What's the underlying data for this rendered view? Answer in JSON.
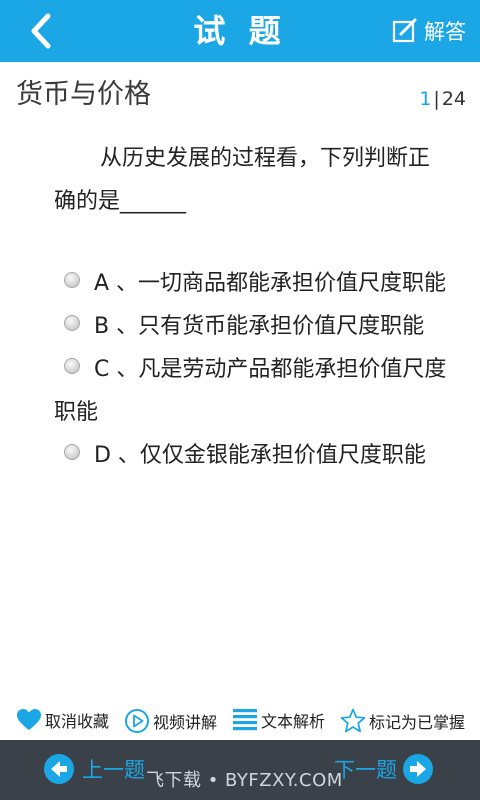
{
  "header": {
    "title": "试 题",
    "answer_label": "解答"
  },
  "subject": "货币与价格",
  "counter": {
    "current": "1",
    "separator": "|",
    "total": "24"
  },
  "question": {
    "line1": "从历史发展的过程看，下列判断正",
    "line2": "确的是______"
  },
  "options": [
    {
      "text": "A 、一切商品都能承担价值尺度职能"
    },
    {
      "text": "B 、只有货币能承担价值尺度职能"
    },
    {
      "text": "C 、凡是劳动产品都能承担价值尺度职能"
    },
    {
      "text": "D 、仅仅金银能承担价值尺度职能"
    }
  ],
  "actions": {
    "unfavorite": "取消收藏",
    "video": "视频讲解",
    "text_analysis": "文本解析",
    "mark_mastered": "标记为已掌握"
  },
  "footer": {
    "prev": "上一题",
    "next": "下一题",
    "watermark": "飞下载 • BYFZXY.COM"
  },
  "colors": {
    "accent": "#1ba6e5",
    "footer_bg": "#3a4149"
  }
}
